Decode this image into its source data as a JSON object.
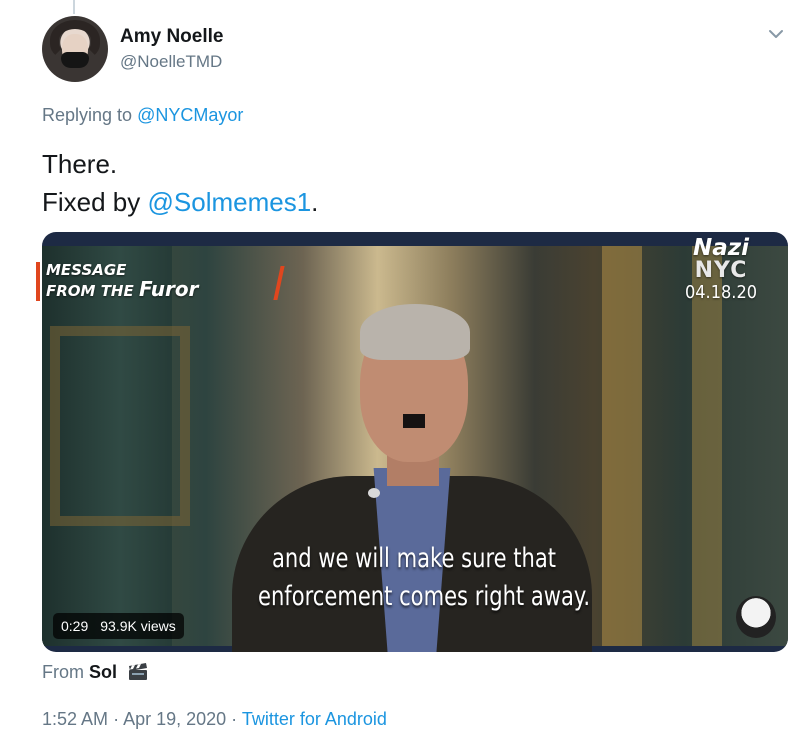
{
  "author": {
    "name": "Amy Noelle",
    "handle": "@NoelleTMD"
  },
  "reply": {
    "prefix": "Replying to",
    "to": "@NYCMayor"
  },
  "tweet": {
    "line1": "There.",
    "line2_prefix": "Fixed by",
    "line2_mention": "@Solmemes1",
    "line2_suffix": "."
  },
  "video": {
    "overlay_line1": "MESSAGE",
    "overlay_line2_a": "FROM THE",
    "overlay_line2_b": "Furor",
    "badge_line1": "Nazi",
    "badge_line2": "NYC",
    "badge_line3": "04.18.20",
    "caption_line1": "and we will make sure that",
    "caption_line2": "enforcement comes right away.",
    "duration": "0:29",
    "views": "93.9K views"
  },
  "source": {
    "prefix": "From",
    "name": "Sol",
    "icon": "clapperboard-icon"
  },
  "footer": {
    "time": "1:52 AM",
    "separator": "·",
    "date": "Apr 19, 2020",
    "app": "Twitter for Android"
  },
  "icons": {
    "menu": "chevron-down-icon"
  },
  "colors": {
    "link": "#1b95e0",
    "secondary": "#657786",
    "accent": "#e0461e"
  }
}
